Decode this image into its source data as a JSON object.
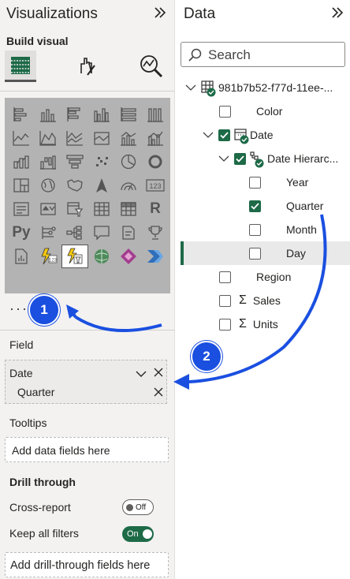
{
  "viz": {
    "title": "Visualizations",
    "build_label": "Build visual",
    "more": "···",
    "py_label": "Py",
    "r_label": "R",
    "card_label": "123",
    "field_well": {
      "label": "Field",
      "item": "Date",
      "sub_item": "Quarter"
    },
    "tooltips": {
      "label": "Tooltips",
      "placeholder": "Add data fields here"
    },
    "drill": {
      "title": "Drill through",
      "cross_report": "Cross-report",
      "cross_report_state": "Off",
      "keep_filters": "Keep all filters",
      "keep_filters_state": "On",
      "placeholder": "Add drill-through fields here"
    }
  },
  "data": {
    "title": "Data",
    "search_placeholder": "Search",
    "table_name": "981b7b52-f77d-11ee-...",
    "fields": {
      "color": "Color",
      "date": "Date",
      "date_hierarchy": "Date Hierarc...",
      "year": "Year",
      "quarter": "Quarter",
      "month": "Month",
      "day": "Day",
      "region": "Region",
      "sales": "Sales",
      "units": "Units",
      "sigma": "Σ"
    }
  },
  "annotations": {
    "step1": "1",
    "step2": "2",
    "arrow_color": "#1a4fe0"
  },
  "colors": {
    "accent": "#1d6a47",
    "annotation": "#1a4fe0"
  }
}
